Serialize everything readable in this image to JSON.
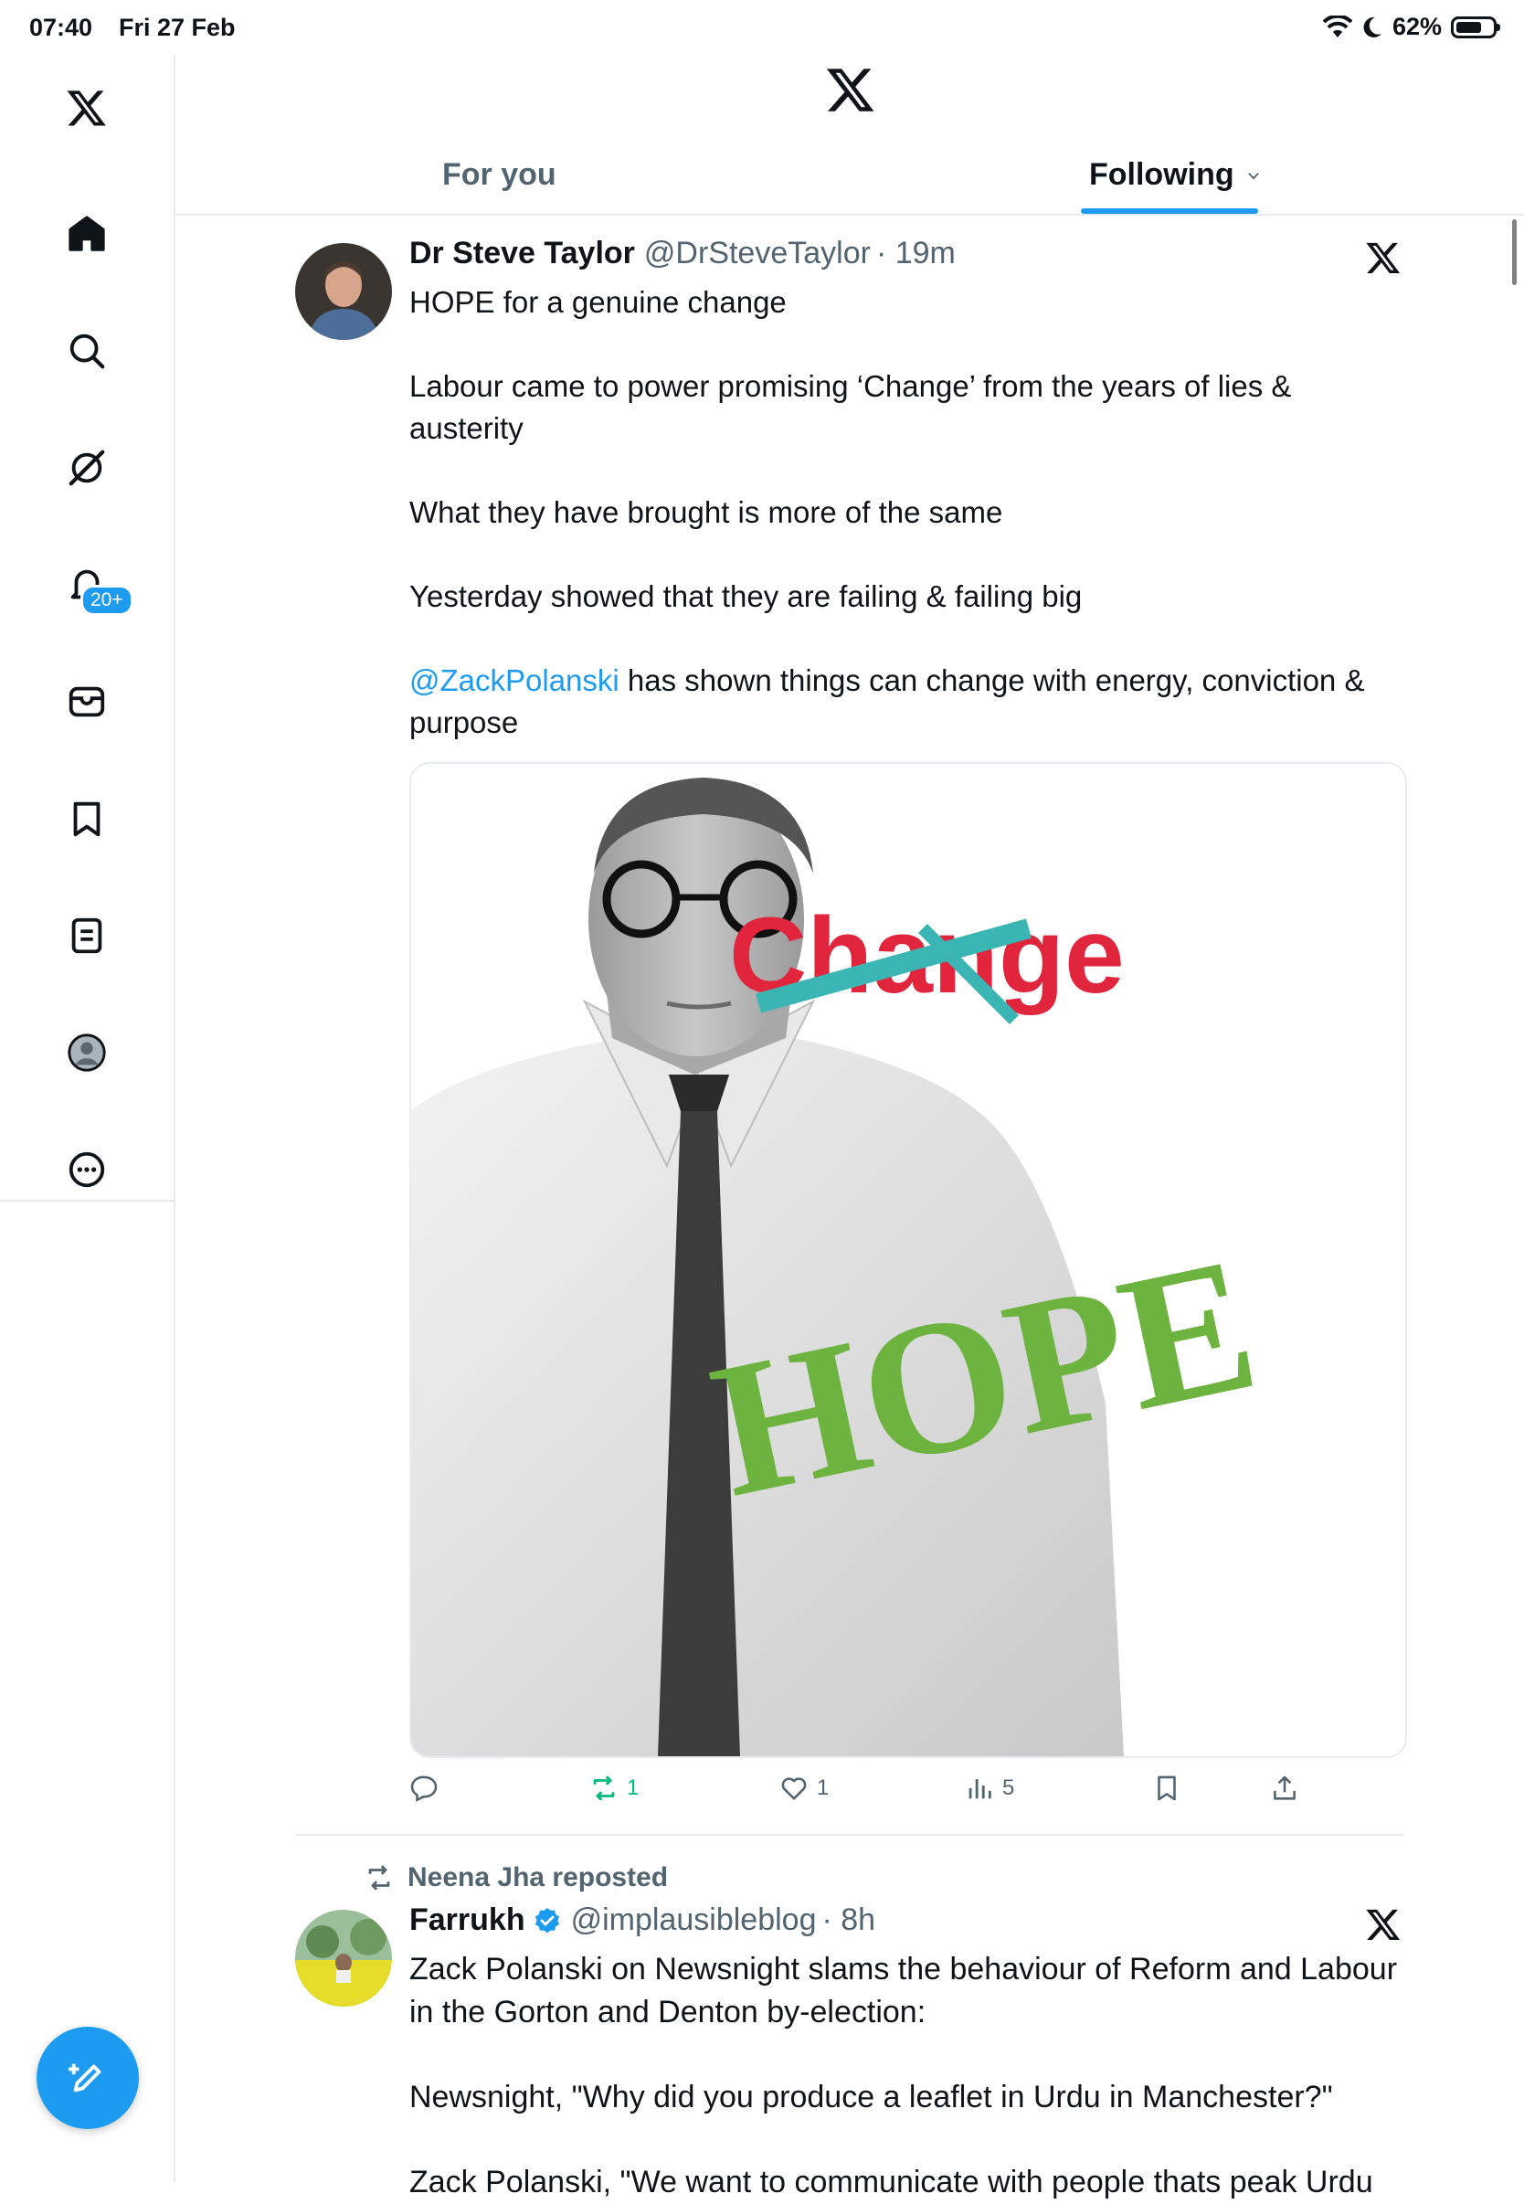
{
  "status_bar": {
    "time": "07:40",
    "date": "Fri 27 Feb",
    "battery": "62%",
    "battery_level": 0.62
  },
  "sidebar": {
    "items": [
      {
        "name": "home-icon"
      },
      {
        "name": "search-icon"
      },
      {
        "name": "grok-icon"
      },
      {
        "name": "notifications-icon"
      },
      {
        "name": "messages-icon"
      },
      {
        "name": "bookmarks-icon"
      },
      {
        "name": "lists-icon"
      },
      {
        "name": "profile-icon"
      },
      {
        "name": "more-icon"
      }
    ],
    "notification_badge": "20+"
  },
  "tabs": {
    "for_you": "For you",
    "following": "Following"
  },
  "post1": {
    "name": "Dr Steve Taylor",
    "handle": "@DrSteveTaylor",
    "time": "· 19m",
    "line1": "HOPE for a genuine change",
    "line2": "Labour came to power promising ‘Change’ from the years of lies & austerity",
    "line3": "What they have brought is more of the same",
    "line4": "Yesterday showed that they are failing & failing big",
    "mention": "@ZackPolanski",
    "line5": " has shown things can change with energy, conviction & purpose",
    "image_text_change": "Change",
    "image_text_hope": "HOPE",
    "actions": {
      "reply": "",
      "repost": "1",
      "like": "1",
      "views": "5"
    }
  },
  "post2": {
    "repost_label": "Neena Jha reposted",
    "name": "Farrukh",
    "handle": "@implausibleblog",
    "time": "· 8h",
    "line1": "Zack Polanski on Newsnight slams the behaviour of Reform and Labour in the Gorton and Denton by-election:",
    "line2": "Newsnight, \"Why did you produce a leaflet in Urdu in Manchester?\"",
    "line3": "Zack Polanski, \"We want to communicate with people thats peak Urdu"
  },
  "colors": {
    "accent": "#1d9bf0",
    "muted": "#536471",
    "repost_green": "#00ba7c",
    "text": "#0f1419"
  }
}
